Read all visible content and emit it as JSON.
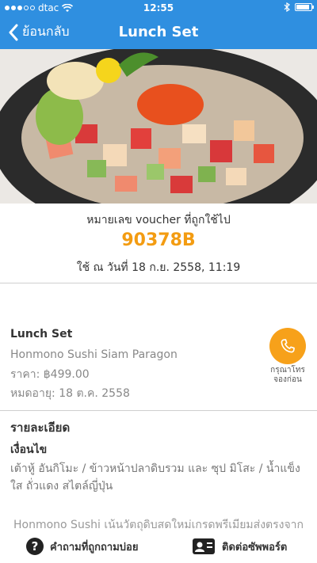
{
  "status_bar": {
    "carrier": "dtac",
    "time": "12:55"
  },
  "nav": {
    "back_label": "ย้อนกลับ",
    "title": "Lunch Set"
  },
  "voucher": {
    "label": "หมายเลข voucher ที่ถูกใช้ไป",
    "code": "90378B",
    "used_at": "ใช้ ณ วันที่ 18 ก.ย. 2558, 11:19"
  },
  "item": {
    "name": "Lunch Set",
    "shop": "Honmono Sushi Siam Paragon",
    "price": "ราคา: ฿499.00",
    "expiry": "หมดอายุ: 18 ต.ค. 2558",
    "call_label_line1": "กรุณาโทร",
    "call_label_line2": "จองก่อน"
  },
  "details": {
    "title": "รายละเอียด",
    "subtitle": "เงื่อนไข",
    "body": "เต้าหู้ อันกิโมะ / ข้าวหน้าปลาดิบรวม และ ซุป มิโสะ / น้ำแข็งใส ถั่วแดง สไตล์ญี่ปุ่น",
    "more": "Honmono Sushi เน้นวัตถุดิบสดใหม่เกรดพรีเมียมส่งตรงจาก"
  },
  "bottom_bar": {
    "faq_label": "คำถามที่ถูกถามบ่อย",
    "support_label": "ติดต่อซัพพอร์ต"
  },
  "colors": {
    "nav_blue": "#2f8fe0",
    "accent_orange": "#f39c12",
    "call_orange": "#f7a11a"
  },
  "icons": [
    "back-chevron-icon",
    "wifi-icon",
    "bluetooth-icon",
    "battery-icon",
    "phone-icon",
    "question-icon",
    "contact-card-icon"
  ]
}
